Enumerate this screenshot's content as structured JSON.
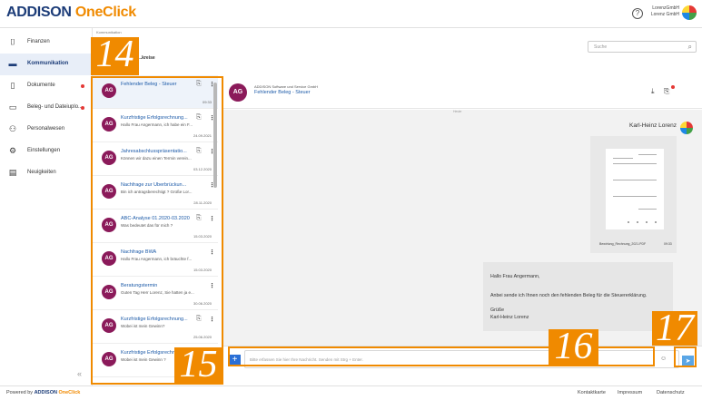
{
  "header": {
    "logo_part1": "ADDISON",
    "logo_part2": "OneClick",
    "help_icon": "?",
    "company_line1": "LorenzGmbH",
    "company_line2": "Lorenz GmbH"
  },
  "sidebar": {
    "items": [
      {
        "label": "Finanzen",
        "icon": "chart-icon",
        "glyph": "⌷"
      },
      {
        "label": "Kommunikation",
        "icon": "chat-icon",
        "glyph": "▬"
      },
      {
        "label": "Dokumente",
        "icon": "document-icon",
        "glyph": "▯"
      },
      {
        "label": "Beleg- und Dateiuplo...",
        "icon": "folder-icon",
        "glyph": "▭"
      },
      {
        "label": "Personalwesen",
        "icon": "people-icon",
        "glyph": "⚇"
      },
      {
        "label": "Einstellungen",
        "icon": "gear-icon",
        "glyph": "⚙"
      },
      {
        "label": "Neuigkeiten",
        "icon": "news-icon",
        "glyph": "▤"
      }
    ],
    "collapse": "«"
  },
  "main": {
    "breadcrumb": "Kommunikation",
    "section_title": "...kreise",
    "search_placeholder": "Suche"
  },
  "conversations": [
    {
      "title": "Fehlender Beleg - Steuer",
      "preview": "",
      "date": "09:33",
      "initials": "AG",
      "attachment": true
    },
    {
      "title": "Kurzfristige Erfolgsrechnung...",
      "preview": "Hallo Frau Angermann, ich habe ein F...",
      "date": "24.09.2021",
      "initials": "AG",
      "attachment": true
    },
    {
      "title": "Jahresabschlusspräsentatio...",
      "preview": "Können wir dazu einen Termin verein...",
      "date": "03.12.2020",
      "initials": "AG",
      "attachment": true
    },
    {
      "title": "Nachfrage zur Überbrückun...",
      "preview": "Bin ich antragsberechtigt ? Grüße Lor...",
      "date": "28.11.2020",
      "initials": "AG",
      "attachment": false
    },
    {
      "title": "ABC-Analyse 01.2020-03.2020",
      "preview": "Was bedeutet das für mich ?",
      "date": "15.03.2020",
      "initials": "AG",
      "attachment": true
    },
    {
      "title": "Nachfrage BWA",
      "preview": "Hallo Frau Angermann, ich bräuchte f...",
      "date": "15.03.2020",
      "initials": "AG",
      "attachment": false
    },
    {
      "title": "Beratungstermin",
      "preview": "Guten Tag Herr Lorenz, Sie hatten ja e...",
      "date": "30.06.2020",
      "initials": "AG",
      "attachment": false
    },
    {
      "title": "Kurzfristige Erfolgsrechnung...",
      "preview": "Wobei ist mein Gewinn?",
      "date": "25.06.2020",
      "initials": "AG",
      "attachment": true
    },
    {
      "title": "Kurzfristige Erfolgsrechnung...",
      "preview": "Wobei ist mein Gewinn ?",
      "date": "",
      "initials": "AG",
      "attachment": false
    }
  ],
  "chat": {
    "initials": "AG",
    "org": "ADDISON Software und Service GmbH",
    "subject": "Fehlender Beleg - Steuer",
    "separator": "Heute",
    "sender": "Karl-Heinz Lorenz",
    "doc_name": "Bewirtung_Rechnung_2021.PDF",
    "doc_time": "09:33",
    "message": {
      "greeting": "Hallo Frau Angermann,",
      "body": "Anbei sende ich Ihnen noch den fehlenden Beleg für die Steuererklärung.",
      "closing": "Grüße",
      "signature": "Karl-Heinz Lorenz"
    },
    "composer_placeholder": "Bitte erfassen Sie hier Ihre Nachricht. Senden mit Strg + Enter."
  },
  "callouts": [
    "14",
    "15",
    "16",
    "17"
  ],
  "footer": {
    "powered_by": "Powered by",
    "powered_a": "ADDISON",
    "powered_b": "OneClick",
    "links": [
      "Kontaktkarte",
      "Impressum",
      "Datenschutz"
    ]
  },
  "colors": {
    "brand_blue": "#1c3c78",
    "brand_orange": "#f08a00",
    "avatar": "#8b1a5a",
    "link_blue": "#1c5aa8"
  }
}
